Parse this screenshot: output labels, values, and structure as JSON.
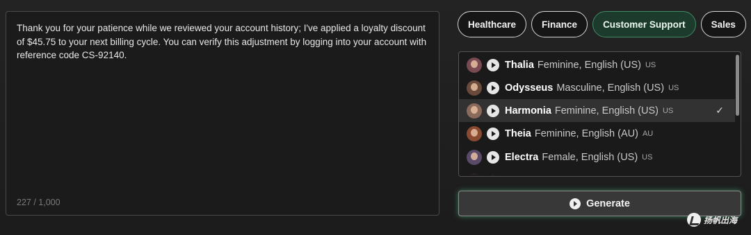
{
  "prompt": {
    "text": "Thank you for your patience while we reviewed your account history; I've applied a loyalty discount of $45.75 to your next billing cycle. You can verify this adjustment by logging into your account with reference code CS-92140.",
    "counter": "227 / 1,000"
  },
  "categories": [
    {
      "label": "Healthcare",
      "active": false
    },
    {
      "label": "Finance",
      "active": false
    },
    {
      "label": "Customer Support",
      "active": true
    },
    {
      "label": "Sales",
      "active": false
    }
  ],
  "voices": [
    {
      "name": "Thalia",
      "description": "Feminine, English (US)",
      "code": "US",
      "selected": false,
      "avatar_color": "#7a4a52"
    },
    {
      "name": "Odysseus",
      "description": "Masculine, English (US)",
      "code": "US",
      "selected": false,
      "avatar_color": "#6a4a3a"
    },
    {
      "name": "Harmonia",
      "description": "Feminine, English (US)",
      "code": "US",
      "selected": true,
      "avatar_color": "#8a6a5a"
    },
    {
      "name": "Theia",
      "description": "Feminine, English (AU)",
      "code": "AU",
      "selected": false,
      "avatar_color": "#8a4a32"
    },
    {
      "name": "Electra",
      "description": "Female, English (US)",
      "code": "US",
      "selected": false,
      "avatar_color": "#5a4a6a"
    }
  ],
  "selected_mark": "✓",
  "generate": {
    "label": "Generate"
  },
  "watermark": {
    "text": "扬帆出海"
  },
  "colors": {
    "accent_green": "#3f8c66",
    "glow": "#50c88c"
  }
}
